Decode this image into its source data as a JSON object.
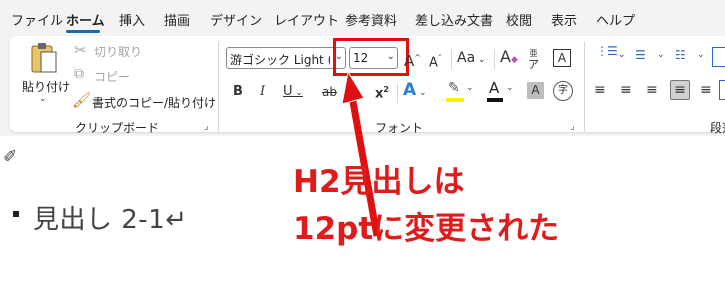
{
  "tabs": [
    "ファイル",
    "ホーム",
    "挿入",
    "描画",
    "デザイン",
    "レイアウト",
    "参考資料",
    "差し込み文書",
    "校閲",
    "表示",
    "ヘルプ"
  ],
  "active_tab": "ホーム",
  "clipboard": {
    "paste_label": "貼り付け",
    "cut_label": "切り取り",
    "copy_label": "コピー",
    "format_painter_label": "書式のコピー/貼り付け",
    "group_label": "クリップボード"
  },
  "font": {
    "font_name": "游ゴシック Light (見出",
    "font_size": "12",
    "group_label": "フォント",
    "bold": "B",
    "italic": "I",
    "underline": "U",
    "strike": "ab",
    "subscript": "x",
    "superscript": "x",
    "grow": "A",
    "shrink": "A",
    "case": "Aa",
    "clear": "A",
    "phonetic": "ア",
    "border": "A",
    "text_effect": "A",
    "font_color": "A",
    "shade": "A",
    "enclose": "字"
  },
  "paragraph": {
    "group_label": "段落"
  },
  "document": {
    "heading": "見出し 2-1↵"
  },
  "annotation": {
    "line1": "H2見出しは",
    "line2": "12ptに変更された"
  },
  "colors": {
    "accent": "#1a6aa8",
    "annotation_red": "#e01010"
  }
}
